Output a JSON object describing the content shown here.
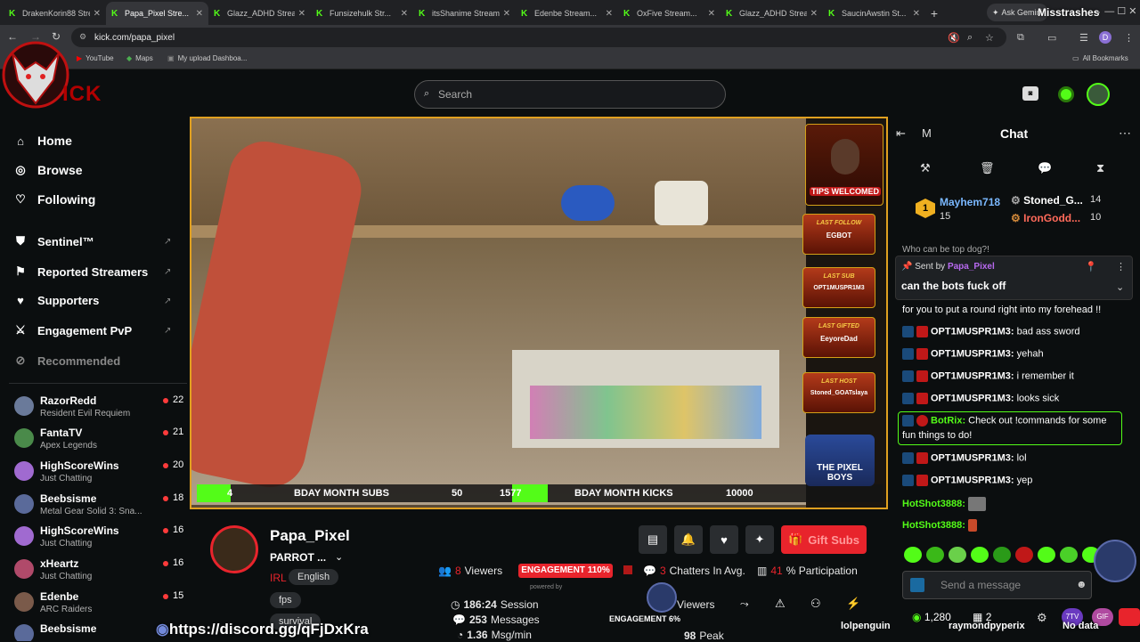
{
  "browser": {
    "tabs": [
      {
        "title": "DrakenKorin88 Stre..."
      },
      {
        "title": "Papa_Pixel Stre...",
        "active": true
      },
      {
        "title": "Glazz_ADHD Strea..."
      },
      {
        "title": "Funsizehulk Str..."
      },
      {
        "title": "itsShanime Stream..."
      },
      {
        "title": "Edenbe Stream..."
      },
      {
        "title": "OxFive Stream..."
      },
      {
        "title": "Glazz_ADHD Strea..."
      },
      {
        "title": "SaucinAwstin St..."
      }
    ],
    "gemini_label": "Ask Gemini",
    "url": "kick.com/papa_pixel",
    "bookmarks": [
      "YouTube",
      "Maps",
      "My upload Dashboa..."
    ],
    "all_bookmarks": "All Bookmarks",
    "profile_initial": "D"
  },
  "overlay_top_right": "Misstrashes",
  "header": {
    "search_placeholder": "Search"
  },
  "sidebar": {
    "nav": [
      {
        "label": "Home",
        "icon": "home-icon"
      },
      {
        "label": "Browse",
        "icon": "compass-icon"
      },
      {
        "label": "Following",
        "icon": "heart-icon"
      }
    ],
    "ext": [
      {
        "label": "Sentinel™"
      },
      {
        "label": "Reported Streamers"
      },
      {
        "label": "Supporters"
      },
      {
        "label": "Engagement PvP"
      },
      {
        "label": "Recommended"
      }
    ],
    "following": [
      {
        "name": "RazorRedd",
        "game": "Resident Evil Requiem",
        "viewers": "22"
      },
      {
        "name": "FantaTV",
        "game": "Apex Legends",
        "viewers": "21"
      },
      {
        "name": "HighScoreWins",
        "game": "Just Chatting",
        "viewers": "20"
      },
      {
        "name": "Beebsisme",
        "game": "Metal Gear Solid 3: Sna...",
        "viewers": "18"
      },
      {
        "name": "HighScoreWins",
        "game": "Just Chatting",
        "viewers": "16"
      },
      {
        "name": "xHeartz",
        "game": "Just Chatting",
        "viewers": "16"
      },
      {
        "name": "Edenbe",
        "game": "ARC Raiders",
        "viewers": "15"
      },
      {
        "name": "Beebsisme",
        "game": "",
        "viewers": ""
      }
    ]
  },
  "video": {
    "left_count": "4",
    "subs_label": "BDAY MONTH SUBS",
    "subs_goal": "50",
    "kicks_count": "1577",
    "kicks_label": "BDAY MONTH KICKS",
    "kicks_goal": "10000",
    "tips": "TIPS WELCOMED",
    "tiles": [
      {
        "head": "LAST FOLLOW",
        "name": "EGBOT"
      },
      {
        "head": "LAST SUB",
        "name": "OPT1MUSPR1M3"
      },
      {
        "head": "LAST GIFTED",
        "name": "EeyoreDad"
      },
      {
        "head": "LAST HOST",
        "name": "Stoned_GOATslaya"
      }
    ],
    "logo_text": "THE PIXEL BOYS"
  },
  "channel": {
    "name": "Papa_Pixel",
    "title": "PARROT ...",
    "tags": [
      "IRL",
      "English",
      "fps",
      "survival"
    ],
    "discord": "https://discord.gg/qFjDxKra",
    "gift_subs": "Gift Subs"
  },
  "stats": {
    "viewers_value": "8",
    "viewers_label": "Viewers",
    "engagement": "ENGAGEMENT 110%",
    "powered": "powered by",
    "chatters_value": "3",
    "chatters_label": "Chatters In Avg.",
    "participation_value": "41",
    "participation_label": "% Participation",
    "session": "186:24",
    "session_label": "Session",
    "messages": "253",
    "messages_label": "Messages",
    "rate": "1.36",
    "rate_label": "Msg/min",
    "viewers2_label": "Viewers",
    "engagement2": "ENGAGEMENT",
    "engagement2_pct": "6%",
    "peak": "98",
    "peak_label": "Peak",
    "bottom_user1": "lolpenguinlol",
    "bottom_user2": "raymondpyperix"
  },
  "chat": {
    "header_letter": "M",
    "title": "Chat",
    "leaderboard": [
      {
        "rank": "1",
        "name": "Mayhem718",
        "count": "15"
      },
      {
        "name": "Stoned_G...",
        "count": "14"
      },
      {
        "name": "IronGodd...",
        "count": "10"
      }
    ],
    "partial_top": "Who can be top dog?!",
    "pinned": {
      "by_label": "Sent by",
      "user": "Papa_Pixel",
      "text": "can the bots fuck off"
    },
    "partial": "for you to put a round right into my forehead !!",
    "messages": [
      {
        "user": "OPT1MUSPR1M3:",
        "text": "bad ass sword"
      },
      {
        "user": "OPT1MUSPR1M3:",
        "text": "yehah"
      },
      {
        "user": "OPT1MUSPR1M3:",
        "text": "i remember it"
      },
      {
        "user": "OPT1MUSPR1M3:",
        "text": "looks sick"
      },
      {
        "user": "BotRix:",
        "text": "Check out !commands for some",
        "text2": "fun things to do!"
      },
      {
        "user": "OPT1MUSPR1M3:",
        "text": "lol"
      },
      {
        "user": "OPT1MUSPR1M3:",
        "text": "yep"
      },
      {
        "user": "HotShot3888:",
        "text": ""
      },
      {
        "user": "HotShot3888:",
        "text": ""
      }
    ],
    "input_placeholder": "Send a message",
    "kicks": "1,280",
    "count2": "2",
    "no_data": "No data"
  },
  "colors": {
    "accent": "#53fc18",
    "red": "#e8242c",
    "chat_green": "#53fc18"
  }
}
